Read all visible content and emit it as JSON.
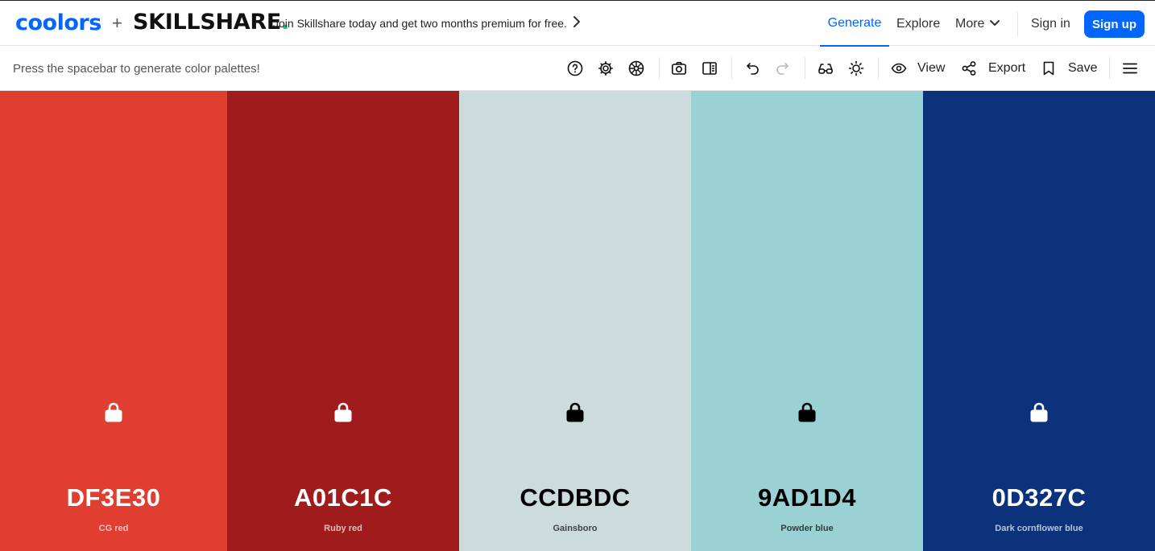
{
  "brand": {
    "coolors": "coolors",
    "plus": "+",
    "skillshare": "SKILLSHARE",
    "skillshare_dot": "."
  },
  "promo": {
    "text": "Join Skillshare today and get two months premium for free.",
    "chevron": "›"
  },
  "nav": {
    "generate": "Generate",
    "explore": "Explore",
    "more": "More",
    "signin": "Sign in",
    "signup": "Sign up"
  },
  "toolbar": {
    "hint": "Press the spacebar to generate color palettes!",
    "view": "View",
    "export": "Export",
    "save": "Save",
    "icons": [
      "help-icon",
      "settings-icon",
      "palette-wheel-icon",
      "camera-icon",
      "sidebar-panel-icon",
      "undo-icon",
      "redo-icon",
      "glasses-icon",
      "brightness-icon",
      "eye-icon",
      "share-icon",
      "bookmark-icon",
      "menu-icon"
    ]
  },
  "colors": {
    "accent": "#0066ff",
    "skillshare_dot": "#00d68f"
  },
  "palette": [
    {
      "hex": "DF3E30",
      "name": "CG red",
      "bg": "#DF3E30",
      "fg": "#ffffff"
    },
    {
      "hex": "A01C1C",
      "name": "Ruby red",
      "bg": "#A01C1C",
      "fg": "#ffffff"
    },
    {
      "hex": "CCDBDC",
      "name": "Gainsboro",
      "bg": "#CCDBDC",
      "fg": "#000000"
    },
    {
      "hex": "9AD1D4",
      "name": "Powder blue",
      "bg": "#9AD1D4",
      "fg": "#000000"
    },
    {
      "hex": "0D327C",
      "name": "Dark cornflower blue",
      "bg": "#0D327C",
      "fg": "#ffffff"
    }
  ]
}
